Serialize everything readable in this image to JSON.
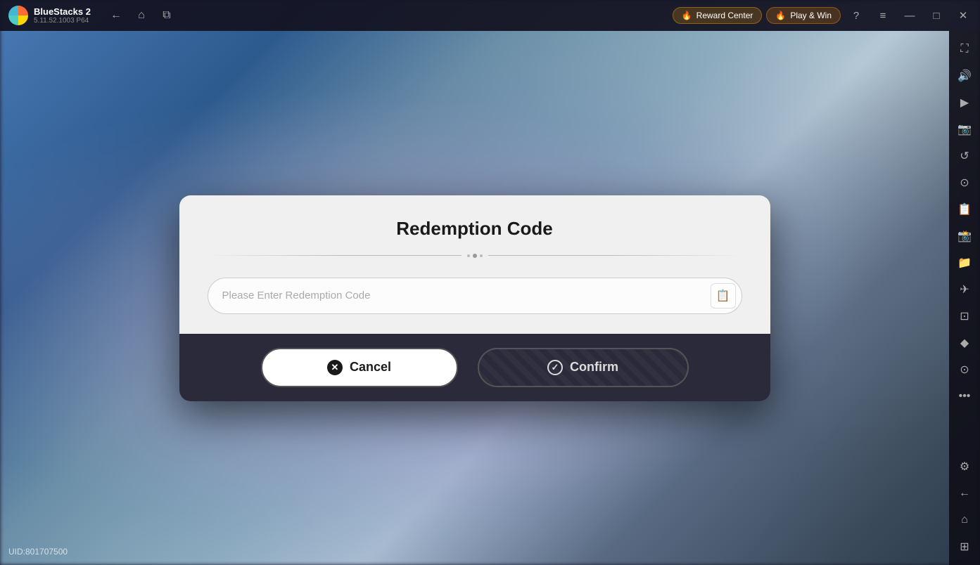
{
  "app": {
    "name": "BlueStacks 2",
    "version": "5.11.52.1003  P64",
    "logo_alt": "BlueStacks logo"
  },
  "topbar": {
    "back_label": "←",
    "home_label": "⌂",
    "tabs_label": "⧉",
    "reward_center_label": "Reward Center",
    "play_win_label": "Play & Win",
    "help_label": "?",
    "menu_label": "≡",
    "minimize_label": "—",
    "maximize_label": "□",
    "close_label": "✕",
    "expand_label": "⇥"
  },
  "sidebar": {
    "items": [
      {
        "icon": "⛶",
        "name": "fullscreen-icon"
      },
      {
        "icon": "🔊",
        "name": "sound-icon"
      },
      {
        "icon": "▶",
        "name": "video-icon"
      },
      {
        "icon": "📷",
        "name": "screenshot-icon"
      },
      {
        "icon": "↺",
        "name": "rotate-icon"
      },
      {
        "icon": "🎮",
        "name": "gamepad-icon"
      },
      {
        "icon": "📋",
        "name": "macro-icon"
      },
      {
        "icon": "📸",
        "name": "camera-icon"
      },
      {
        "icon": "📁",
        "name": "folder-icon"
      },
      {
        "icon": "✈",
        "name": "airplane-icon"
      },
      {
        "icon": "⊡",
        "name": "resize-icon"
      },
      {
        "icon": "◆",
        "name": "features-icon"
      },
      {
        "icon": "⊙",
        "name": "location-icon"
      },
      {
        "icon": "•••",
        "name": "more-icon"
      },
      {
        "icon": "⚙",
        "name": "settings-icon"
      },
      {
        "icon": "←",
        "name": "back-sidebar-icon"
      },
      {
        "icon": "⌂",
        "name": "home-sidebar-icon"
      },
      {
        "icon": "⊞",
        "name": "grid-icon"
      }
    ]
  },
  "modal": {
    "title": "Redemption Code",
    "input_placeholder": "Please Enter Redemption Code",
    "cancel_label": "Cancel",
    "confirm_label": "Confirm"
  },
  "footer": {
    "uid_label": "UID:801707500"
  }
}
